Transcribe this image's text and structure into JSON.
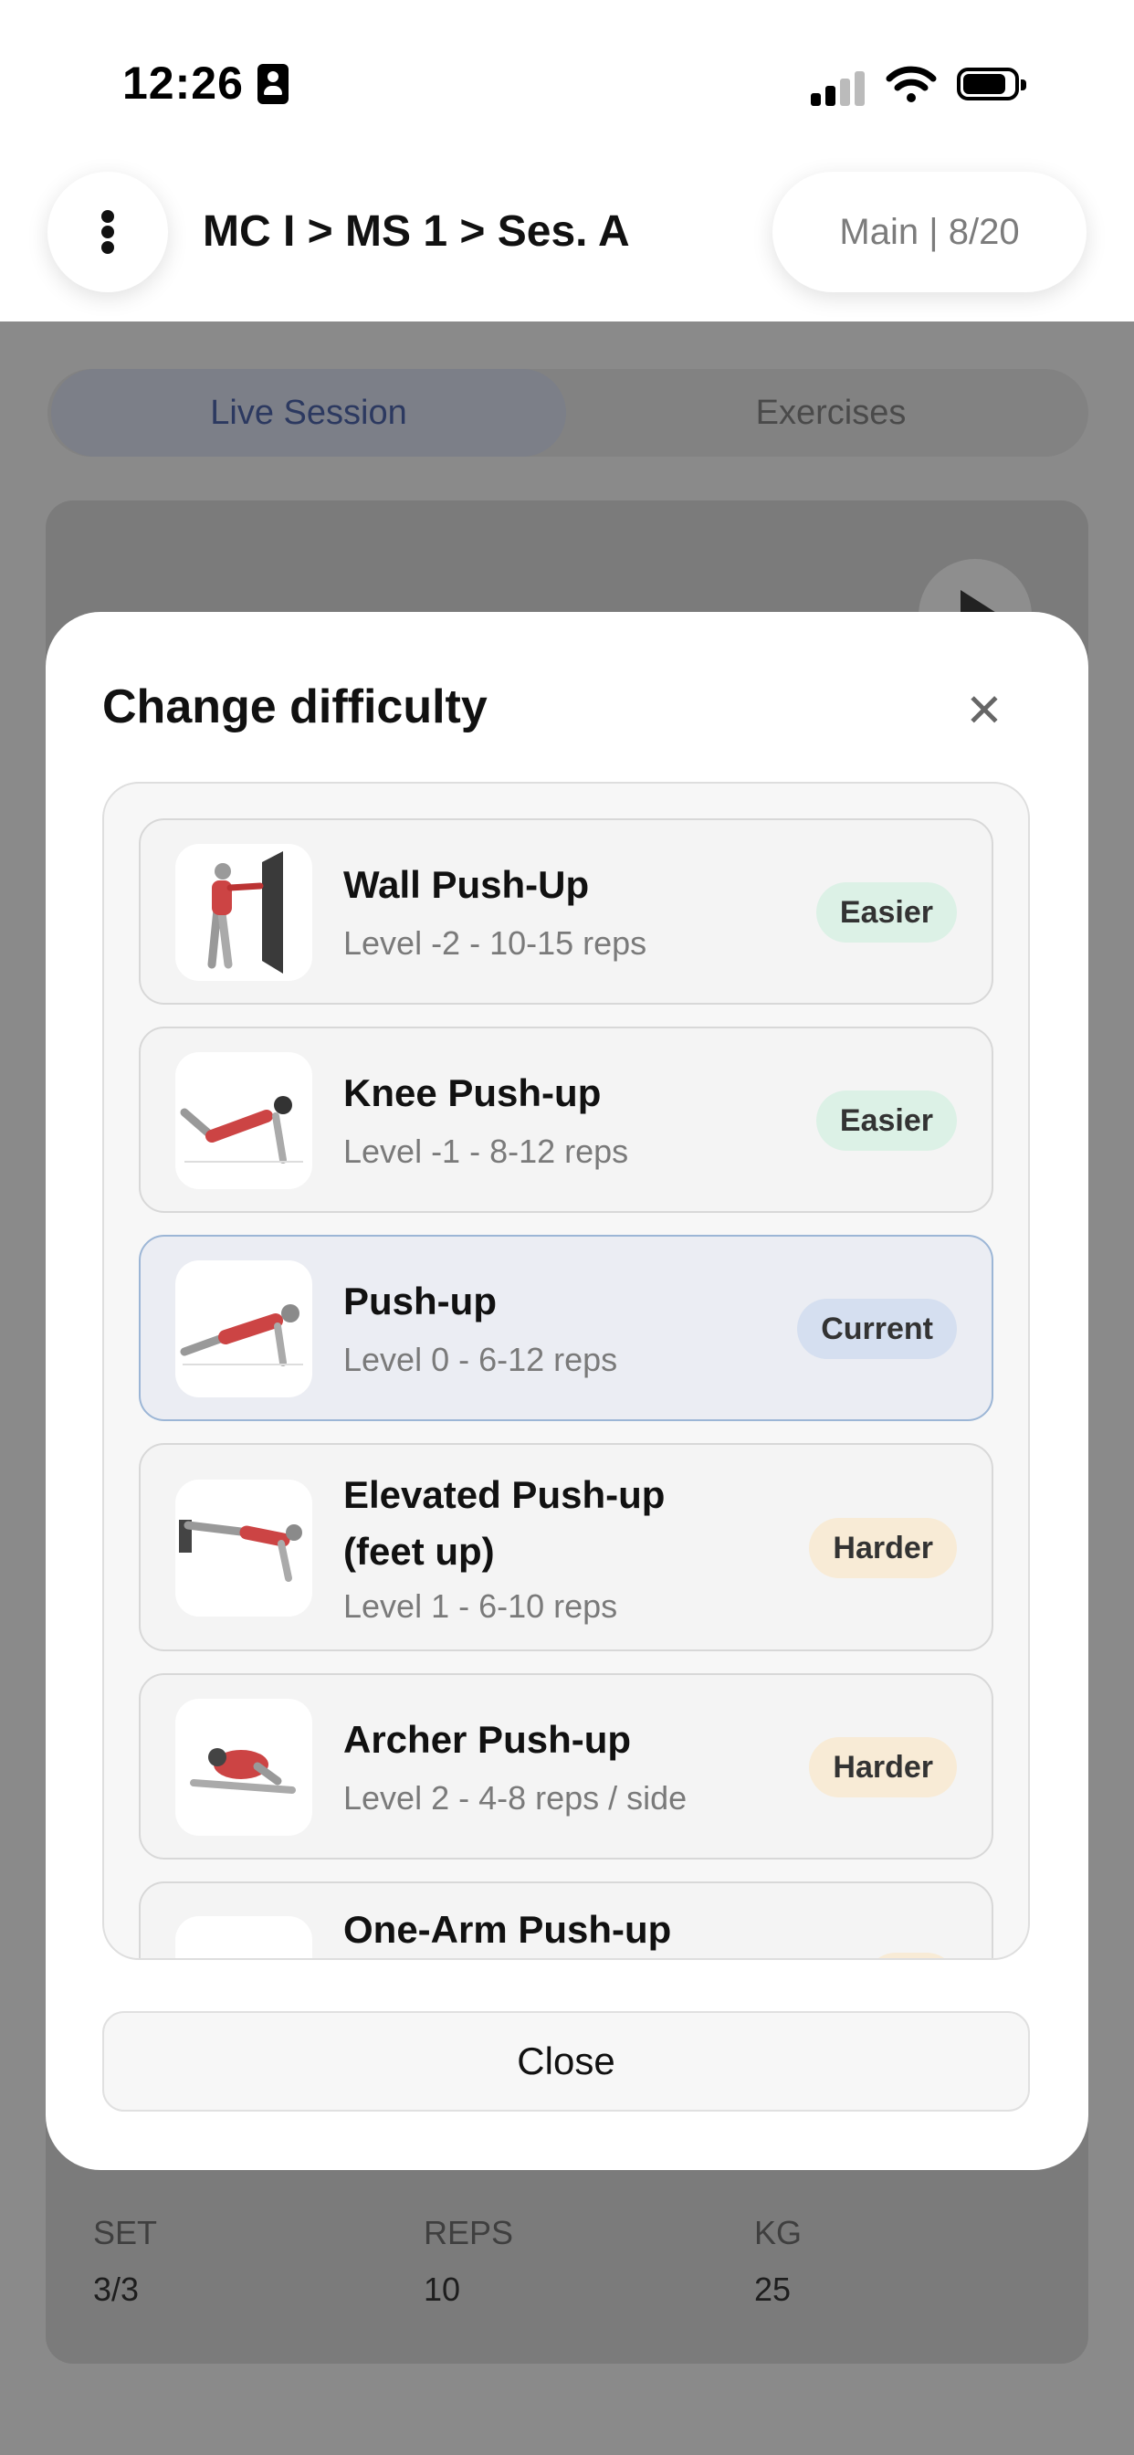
{
  "status_bar": {
    "time": "12:26"
  },
  "header": {
    "breadcrumb": "MC I > MS 1 > Ses. A",
    "progress": "Main | 8/20"
  },
  "background": {
    "tabs": [
      "Live Session",
      "Exercises"
    ],
    "stats": {
      "labels": [
        "SET",
        "REPS",
        "KG"
      ],
      "values": [
        "3/3",
        "10",
        "25"
      ]
    }
  },
  "modal": {
    "title": "Change difficulty",
    "close_label": "Close",
    "exercises": [
      {
        "name": "Wall Push-Up",
        "sub": "Level -2 - 10-15 reps",
        "badge": "Easier"
      },
      {
        "name": "Knee Push-up",
        "sub": "Level -1 - 8-12 reps",
        "badge": "Easier"
      },
      {
        "name": "Push-up",
        "sub": "Level 0 - 6-12 reps",
        "badge": "Current"
      },
      {
        "name_line1": "Elevated Push-up",
        "name_line2": "(feet up)",
        "sub": "Level 1 - 6-10 reps",
        "badge": "Harder"
      },
      {
        "name": "Archer Push-up",
        "sub": "Level 2 - 4-8 reps / side",
        "badge": "Harder"
      },
      {
        "name": "One-Arm Push-up"
      }
    ]
  },
  "colors": {
    "easier_badge": "#dcf1e6",
    "current_badge": "#d5dff0",
    "harder_badge": "#f8ebd6",
    "current_border": "#9cb6d6"
  }
}
